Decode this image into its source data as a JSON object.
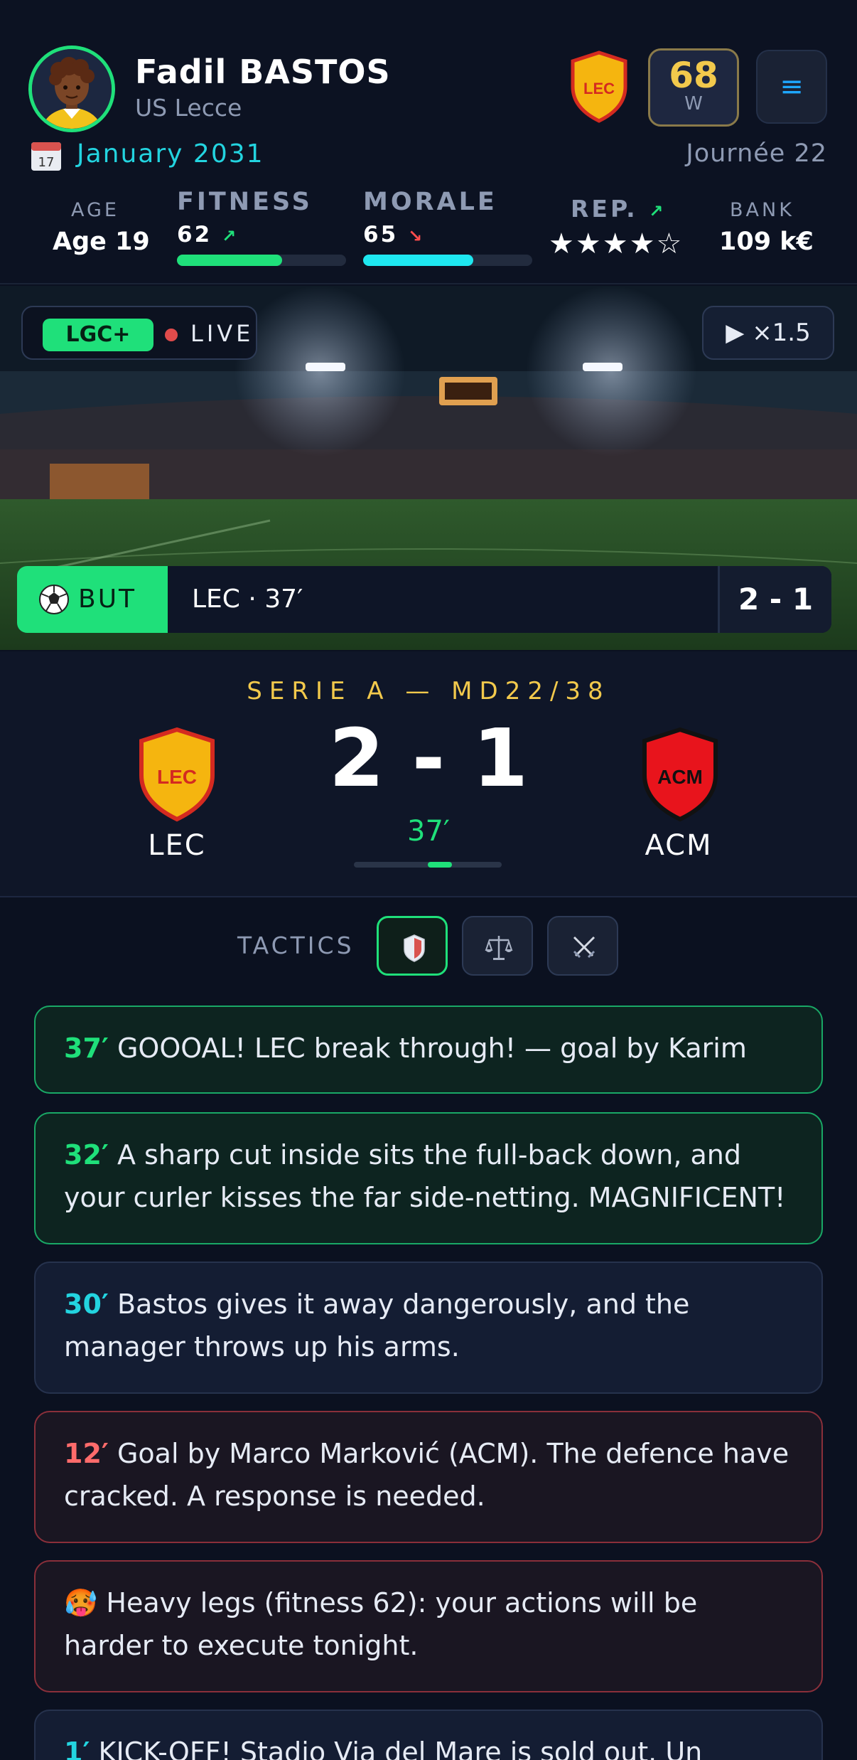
{
  "player": {
    "name": "Fadil BASTOS",
    "club": "US Lecce",
    "rating_value": "68",
    "rating_label": "W",
    "menu_icon": "≡"
  },
  "calendar": {
    "icon_day": "17",
    "date": "January 2031",
    "matchday": "Journée 22"
  },
  "stats": {
    "age_label": "AGE",
    "age_value": "Age 19",
    "fitness_label": "FITNESS",
    "fitness_value": "62",
    "fitness_trend": "↗",
    "fitness_level": 0.62,
    "morale_label": "MORALE",
    "morale_value": "65",
    "morale_trend": "↘",
    "morale_level": 0.65,
    "rep_label": "REP.",
    "rep_trend": "↗",
    "rep_stars": "★★★★☆",
    "rep_rating": 4,
    "bank_label": "BANK",
    "bank_value": "109 k€"
  },
  "broadcast": {
    "channel": "LGC+",
    "live_label": "LIVE",
    "speed": "▶ ×1.5",
    "event_tag": "BUT",
    "event_text": "LEC · 37′",
    "event_score": "2 - 1"
  },
  "match": {
    "competition": "SERIE A — MD22/38",
    "home_code": "LEC",
    "away_code": "ACM",
    "score": "2 - 1",
    "minute": "37′",
    "progress": 0.41
  },
  "tactics": {
    "label": "TACTICS",
    "options": [
      "defensive",
      "balanced",
      "attacking"
    ],
    "selected": "defensive"
  },
  "feed": [
    {
      "minute": "37′",
      "text": " GOOOAL! LEC break through! — goal by Karim",
      "style": "green"
    },
    {
      "minute": "32′",
      "text": " A sharp cut inside sits the full-back down, and your curler kisses the far side-netting. MAGNIFICENT!",
      "style": "green"
    },
    {
      "minute": "30′",
      "text": " Bastos gives it away dangerously, and the manager throws up his arms.",
      "style": "blue"
    },
    {
      "minute": "12′",
      "text": " Goal by Marco Marković (ACM). The defence have cracked. A response is needed.",
      "style": "red"
    },
    {
      "minute": "🥵",
      "text": " Heavy legs (fitness 62): your actions will be harder to execute tonight.",
      "style": "red"
    },
    {
      "minute": "1′",
      "text": " KICK-OFF! Stadio Via del Mare is sold out. Un",
      "style": "blue"
    }
  ],
  "colors": {
    "accent_green": "#1fe07a",
    "accent_cyan": "#23d4e0",
    "gold": "#f2c94c",
    "danger": "#ff6b6b",
    "background": "#0b1120"
  }
}
